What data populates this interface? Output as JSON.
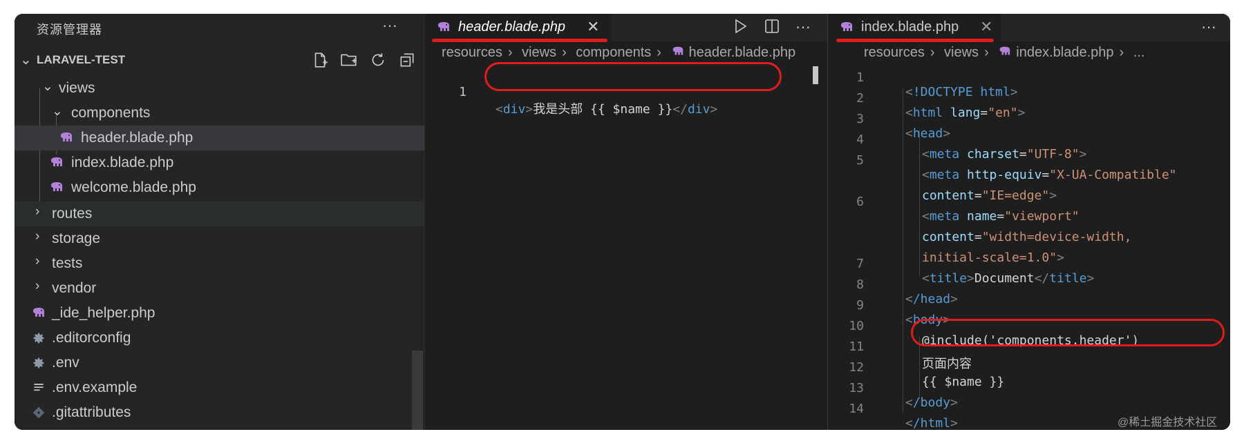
{
  "sidebar": {
    "title": "资源管理器",
    "more": "···",
    "project": "LARAVEL-TEST",
    "tree": [
      {
        "label": "views",
        "type": "folder-open"
      },
      {
        "label": "components",
        "type": "folder-open"
      },
      {
        "label": "header.blade.php",
        "type": "blade"
      },
      {
        "label": "index.blade.php",
        "type": "blade"
      },
      {
        "label": "welcome.blade.php",
        "type": "blade"
      },
      {
        "label": "routes",
        "type": "folder"
      },
      {
        "label": "storage",
        "type": "folder"
      },
      {
        "label": "tests",
        "type": "folder"
      },
      {
        "label": "vendor",
        "type": "folder"
      },
      {
        "label": "_ide_helper.php",
        "type": "php"
      },
      {
        "label": ".editorconfig",
        "type": "gear"
      },
      {
        "label": ".env",
        "type": "gear"
      },
      {
        "label": ".env.example",
        "type": "lines"
      },
      {
        "label": ".gitattributes",
        "type": "git"
      }
    ]
  },
  "left_editor": {
    "tab": "header.blade.php",
    "close": "✕",
    "more": "···",
    "breadcrumb": [
      "resources",
      "views",
      "components",
      "header.blade.php"
    ],
    "line_number": "1",
    "code": {
      "open_tag": "div",
      "text": "我是头部 {{ $name }}",
      "close_tag": "div"
    }
  },
  "right_editor": {
    "tab": "index.blade.php",
    "close": "✕",
    "more": "···",
    "breadcrumb": [
      "resources",
      "views",
      "index.blade.php",
      "..."
    ],
    "line_numbers": [
      "1",
      "2",
      "3",
      "4",
      "5",
      "",
      "6",
      "",
      "",
      "7",
      "8",
      "9",
      "10",
      "11",
      "12",
      "13",
      "14"
    ],
    "lines": {
      "l1": "!DOCTYPE html",
      "l2_tag": "html",
      "l2_attr": "lang",
      "l2_val": "\"en\"",
      "l3": "head",
      "l4_tag": "meta",
      "l4_attr": "charset",
      "l4_val": "\"UTF-8\"",
      "l5_tag": "meta",
      "l5_attr": "http-equiv",
      "l5_val": "\"X-UA-Compatible\"",
      "l5b_attr": "content",
      "l5b_val": "\"IE=edge\"",
      "l6_tag": "meta",
      "l6_attr": "name",
      "l6_val": "\"viewport\"",
      "l6b_attr": "content",
      "l6b_val": "\"width=device-width,",
      "l6c_val": "initial-scale=1.0\"",
      "l7_tag": "title",
      "l7_text": "Document",
      "l8": "/head",
      "l9": "body",
      "l10": "@include('components.header')",
      "l11": "页面内容",
      "l12": "{{ $name }}",
      "l13": "/body",
      "l14": "/html"
    }
  },
  "watermark": "@稀土掘金技术社区",
  "colors": {
    "accent_annotation": "#e11c1c",
    "tag": "#569cd6",
    "attr": "#9cdcfe",
    "string": "#ce9178"
  }
}
